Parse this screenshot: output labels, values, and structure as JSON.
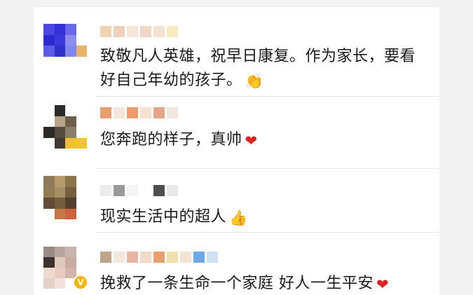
{
  "comments": [
    {
      "text": "致敬凡人英雄，祝早日康复。作为家长，要看好自己年幼的孩子。",
      "emoji": "👏",
      "emoji_icon": "clap-icon"
    },
    {
      "text": "您奔跑的样子，真帅",
      "emoji": "❤",
      "emoji_icon": "heart-icon"
    },
    {
      "text": "现实生活中的超人",
      "emoji": "👍",
      "emoji_icon": "thumbs-up-icon"
    },
    {
      "text": "挽救了一条生命一个家庭 好人一生平安",
      "emoji": "❤",
      "emoji_icon": "heart-icon"
    }
  ],
  "colors": {
    "text": "#1a1a1a",
    "heart": "#e02121",
    "verified_badge": "#f7b500",
    "divider": "#e6e6e6"
  },
  "badge": {
    "icon": "verified-v-icon",
    "glyph": "V"
  }
}
